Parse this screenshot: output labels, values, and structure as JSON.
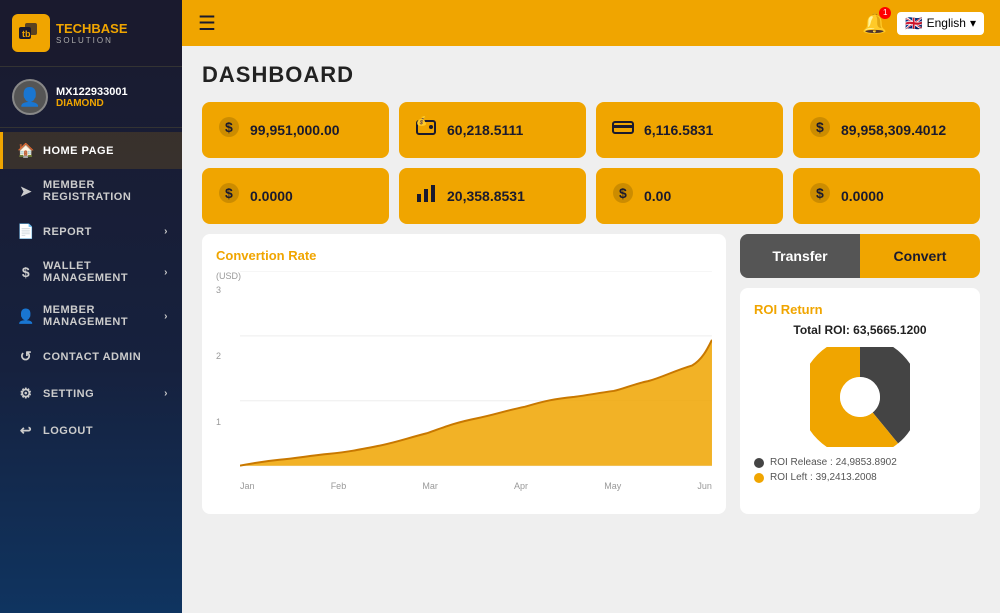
{
  "sidebar": {
    "logo_letters": "tb",
    "logo_name": "TECHBASE",
    "logo_sub": "SOLUTION",
    "user": {
      "id": "MX122933001",
      "rank": "DIAMOND"
    },
    "nav_items": [
      {
        "label": "HOME PAGE",
        "icon": "🏠",
        "active": true,
        "arrow": false
      },
      {
        "label": "MEMBER REGISTRATION",
        "icon": "➤",
        "active": false,
        "arrow": false
      },
      {
        "label": "REPORT",
        "icon": "📄",
        "active": false,
        "arrow": true
      },
      {
        "label": "WALLET MANAGEMENT",
        "icon": "$",
        "active": false,
        "arrow": true
      },
      {
        "label": "MEMBER MANAGEMENT",
        "icon": "👤",
        "active": false,
        "arrow": true
      },
      {
        "label": "CONTACT ADMIN",
        "icon": "↺",
        "active": false,
        "arrow": false
      },
      {
        "label": "SETTING",
        "icon": "⚙",
        "active": false,
        "arrow": true
      },
      {
        "label": "LOGOUT",
        "icon": "↩",
        "active": false,
        "arrow": false
      }
    ]
  },
  "topbar": {
    "lang": "English",
    "flag": "🇬🇧"
  },
  "page": {
    "title": "DASHBOARD"
  },
  "stats": [
    {
      "icon": "$",
      "value": "99,951,000.00",
      "icon_type": "dollar"
    },
    {
      "icon": "💰",
      "value": "60,218.5111",
      "icon_type": "wallet"
    },
    {
      "icon": "▬",
      "value": "6,116.5831",
      "icon_type": "card"
    },
    {
      "icon": "$",
      "value": "89,958,309.4012",
      "icon_type": "dollar"
    },
    {
      "icon": "$",
      "value": "0.0000",
      "icon_type": "dollar"
    },
    {
      "icon": "📊",
      "value": "20,358.8531",
      "icon_type": "chart"
    },
    {
      "icon": "$",
      "value": "0.00",
      "icon_type": "dollar"
    },
    {
      "icon": "$",
      "value": "0.0000",
      "icon_type": "dollar"
    }
  ],
  "chart": {
    "title": "Convertion Rate",
    "y_labels": [
      "3",
      "2",
      "1"
    ],
    "x_labels": [
      "Jan",
      "Feb",
      "Mar",
      "Apr",
      "May",
      "Jun"
    ],
    "y_axis_label": "(USD)"
  },
  "actions": {
    "transfer_label": "Transfer",
    "convert_label": "Convert"
  },
  "roi": {
    "title": "ROI Return",
    "total_label": "Total ROI: 63,5665.1200",
    "release_label": "ROI Release : 24,9853.8902",
    "left_label": "ROI Left   : 39,2413.2008",
    "release_color": "#444",
    "left_color": "#f0a500",
    "release_percent": 39,
    "left_percent": 61
  }
}
